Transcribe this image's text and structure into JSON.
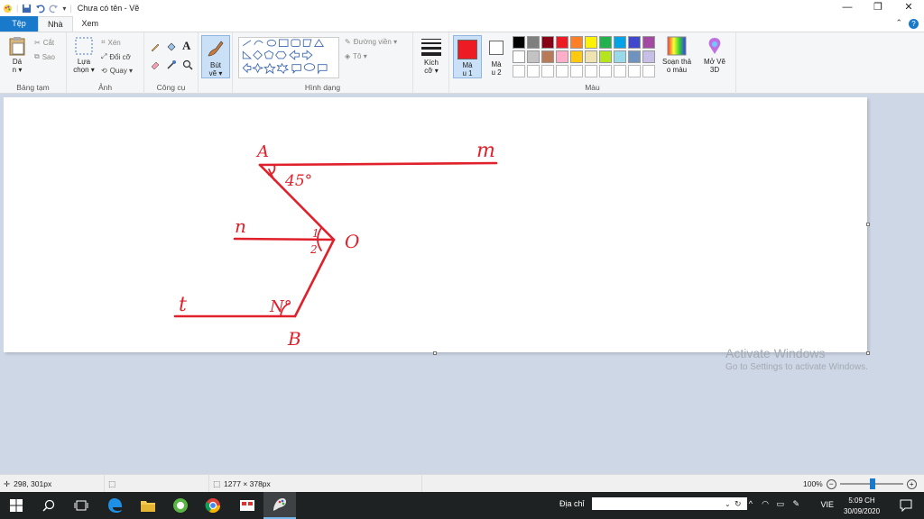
{
  "window": {
    "title": "Chưa có tên - Vẽ",
    "controls": {
      "minimize": "—",
      "maximize": "❐",
      "close": "✕"
    }
  },
  "tabs": [
    {
      "label": "Tệp"
    },
    {
      "label": "Nhà"
    },
    {
      "label": "Xem"
    }
  ],
  "ribbon": {
    "clipboard": {
      "paste": "Dá\nn ▾",
      "cut": "Cắt",
      "copy": "Sao",
      "group_label": "Bảng tạm"
    },
    "image": {
      "select": "Lựa\nchọn ▾",
      "crop": "Xén",
      "resize": "Đổi cỡ",
      "rotate": "Quay ▾",
      "group_label": "Ảnh"
    },
    "tools": {
      "group_label": "Công cụ",
      "text_tool": "A"
    },
    "brushes": {
      "label": "Bút\nvẽ ▾"
    },
    "shapes": {
      "outline": "Đường viền ▾",
      "fill": "Tô ▾",
      "group_label": "Hình dạng"
    },
    "size": {
      "label": "Kích\ncỡ ▾"
    },
    "colors": {
      "color1_label": "Mà\nu 1",
      "color2_label": "Mà\nu 2",
      "edit_colors": "Soạn thả\no màu",
      "paint3d": "Mở Vẽ\n3D",
      "group_label": "Màu",
      "color1": "#ed1c24",
      "color2": "#ffffff",
      "palette_row1": [
        "#000000",
        "#7f7f7f",
        "#880015",
        "#ed1c24",
        "#ff7f27",
        "#fff200",
        "#22b14c",
        "#00a2e8",
        "#3f48cc",
        "#a349a4"
      ],
      "palette_row2": [
        "#ffffff",
        "#c3c3c3",
        "#b97a57",
        "#ffaec9",
        "#ffc90e",
        "#efe4b0",
        "#b5e61d",
        "#99d9ea",
        "#7092be",
        "#c8bfe7"
      ],
      "palette_row3": [
        "#ffffff",
        "#ffffff",
        "#ffffff",
        "#ffffff",
        "#ffffff",
        "#ffffff",
        "#ffffff",
        "#ffffff",
        "#ffffff",
        "#ffffff"
      ]
    }
  },
  "drawing": {
    "labels": {
      "A_top": "A",
      "m": "m",
      "angle45": "45°",
      "n": "n",
      "one": "1",
      "two": "2",
      "O": "O",
      "t": "t",
      "angle_bottom": "N°",
      "B": "B"
    },
    "stroke_color": "#e0202a"
  },
  "watermark": {
    "line1": "Activate Windows",
    "line2": "Go to Settings to activate Windows."
  },
  "status": {
    "cursor_pos": "298, 301px",
    "canvas_size": "1277 × 378px",
    "zoom": "100%"
  },
  "taskbar": {
    "address_label": "Địa chỉ",
    "lang": "VIE",
    "time": "5:09 CH",
    "date": "30/09/2020"
  }
}
